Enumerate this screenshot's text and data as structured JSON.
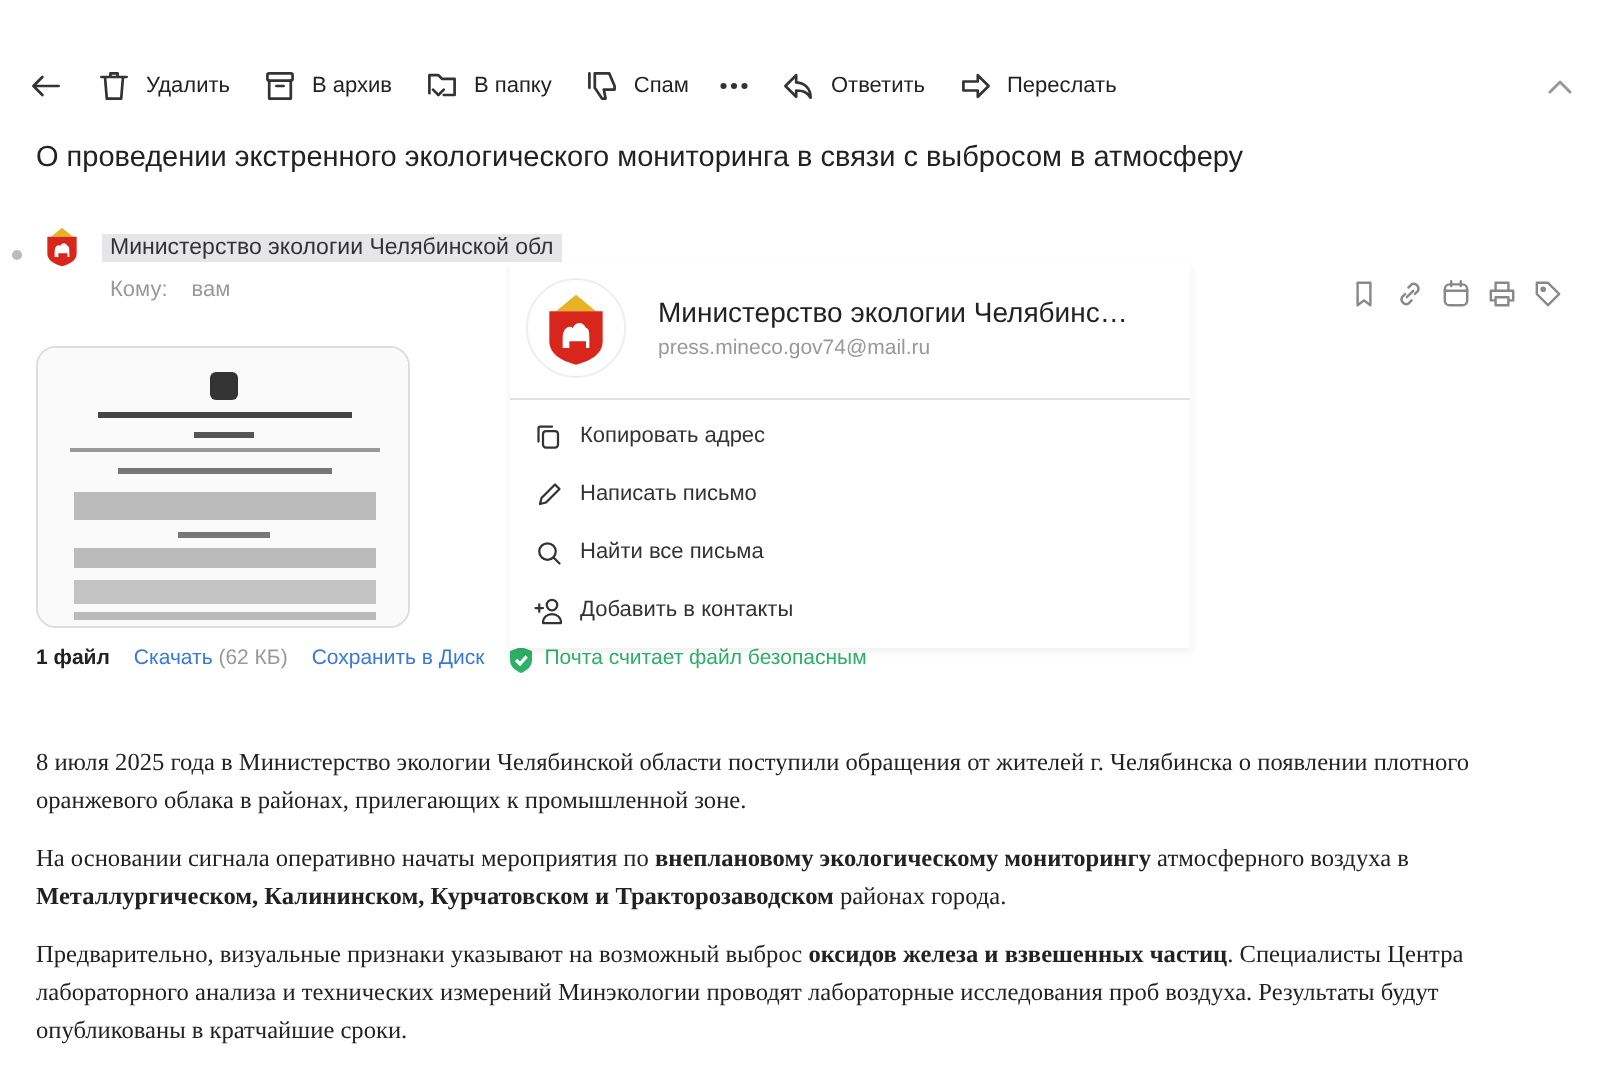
{
  "toolbar": {
    "actions": [
      {
        "kind": "delete",
        "label": "Удалить"
      },
      {
        "kind": "archive",
        "label": "В архив"
      },
      {
        "kind": "folder",
        "label": "В папку"
      },
      {
        "kind": "spam",
        "label": "Спам"
      },
      {
        "kind": "more"
      },
      {
        "kind": "reply",
        "label": "Ответить"
      },
      {
        "kind": "forward",
        "label": "Переслать"
      }
    ]
  },
  "subject": "О проведении экстренного экологического мониторинга в связи с выбросом в атмосферу",
  "sender": {
    "name": "Министерство экологии Челябинской обл",
    "to_label": "Кому:",
    "to": "вам"
  },
  "contact_popup": {
    "name": "Министерство экологии Челябинс…",
    "email": "press.mineco.gov74@mail.ru",
    "actions": [
      {
        "kind": "copy",
        "label": "Копировать адрес"
      },
      {
        "kind": "write",
        "label": "Написать письмо"
      },
      {
        "kind": "search",
        "label": "Найти все письма"
      },
      {
        "kind": "add-contact",
        "label": "Добавить в контакты"
      }
    ]
  },
  "attachments": {
    "count": "1 файл",
    "download": "Скачать",
    "size": "(62 КБ)",
    "save": "Сохранить в Диск",
    "safety": "Почта считает файл безопасным"
  },
  "body": [
    "8 июля 2025 года в Министерство экологии Челябинской области поступили обращения от жителей г. Челябинска о появлении плотного оранжевого облака в районах, прилегающих к промышленной зоне.",
    "На основании сигнала оперативно начаты мероприятия по **внеплановому экологическому мониторингу** атмосферного воздуха в **Металлургическом, Калининском, Курчатовском и Тракторозаводском** районах города.",
    "Предварительно, визуальные признаки указывают на возможный выброс **оксидов железа и взвешенных частиц**. Специалисты Центра лабораторного анализа и технических измерений Минэкологии проводят лабораторные исследования проб воздуха. Результаты будут опубликованы в кратчайшие сроки."
  ]
}
